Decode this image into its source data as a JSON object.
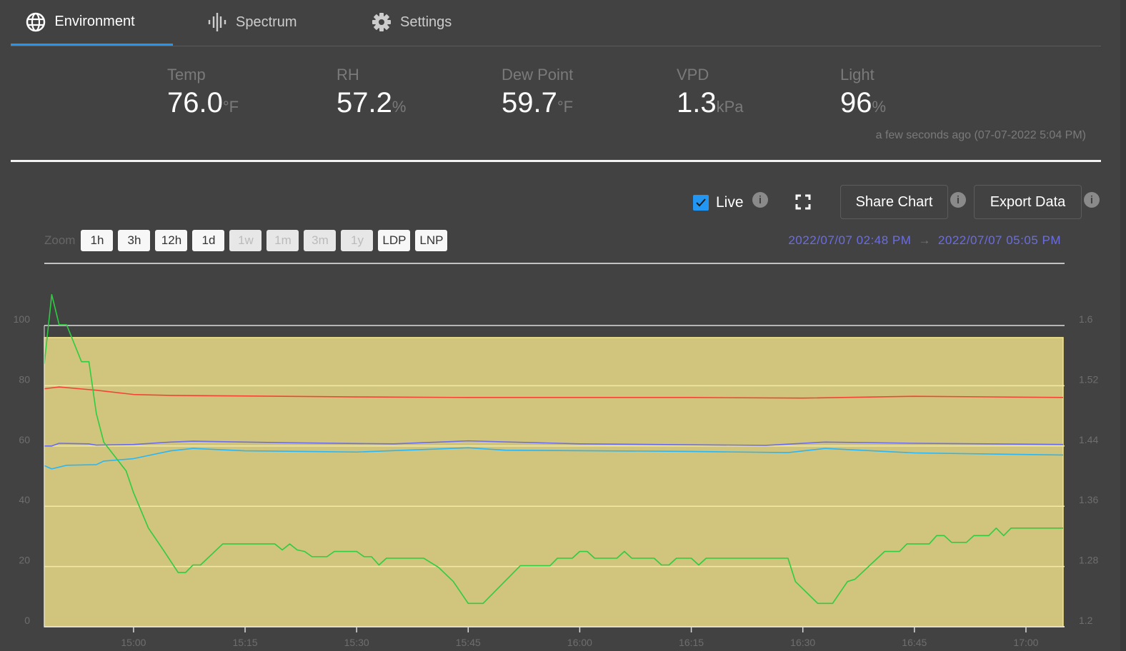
{
  "tabs": [
    {
      "label": "Environment",
      "icon": "globe-icon",
      "active": true
    },
    {
      "label": "Spectrum",
      "icon": "spectrum-icon",
      "active": false
    },
    {
      "label": "Settings",
      "icon": "gear-icon",
      "active": false
    }
  ],
  "metrics": [
    {
      "label": "Temp",
      "value": "76.0",
      "unit": "°F"
    },
    {
      "label": "RH",
      "value": "57.2",
      "unit": "%"
    },
    {
      "label": "Dew Point",
      "value": "59.7",
      "unit": "°F"
    },
    {
      "label": "VPD",
      "value": "1.3",
      "unit": "kPa"
    },
    {
      "label": "Light",
      "value": "96",
      "unit": "%"
    }
  ],
  "updated": "a few seconds ago (07-07-2022 5:04 PM)",
  "toolbar": {
    "live_label": "Live",
    "live_checked": true,
    "share_label": "Share Chart",
    "export_label": "Export Data"
  },
  "zoom": {
    "label": "Zoom",
    "buttons": [
      {
        "label": "1h",
        "enabled": true
      },
      {
        "label": "3h",
        "enabled": true
      },
      {
        "label": "12h",
        "enabled": true
      },
      {
        "label": "1d",
        "enabled": true
      },
      {
        "label": "1w",
        "enabled": false
      },
      {
        "label": "1m",
        "enabled": false
      },
      {
        "label": "3m",
        "enabled": false
      },
      {
        "label": "1y",
        "enabled": false
      },
      {
        "label": "LDP",
        "enabled": true
      },
      {
        "label": "LNP",
        "enabled": true
      }
    ]
  },
  "range": {
    "from": "2022/07/07 02:48 PM",
    "arrow": "→",
    "to": "2022/07/07 05:05 PM"
  },
  "colors": {
    "accent": "#2196f3",
    "temp": "#f44336",
    "rh": "#6a6cf0",
    "dew_point": "#29b6f6",
    "vpd": "#2ecc40",
    "light": "#d1c57e"
  },
  "chart_data": {
    "type": "line",
    "x_range": [
      "14:48",
      "17:05"
    ],
    "x_ticks": [
      "15:00",
      "15:15",
      "15:30",
      "15:45",
      "16:00",
      "16:15",
      "16:30",
      "16:45",
      "17:00"
    ],
    "y_left": {
      "range": [
        0,
        100
      ],
      "ticks": [
        "0",
        "20",
        "40",
        "60",
        "80",
        "100"
      ]
    },
    "y_right": {
      "range": [
        1.2,
        1.6
      ],
      "ticks": [
        "1.2",
        "1.28",
        "1.36",
        "1.44",
        "1.52",
        "1.6"
      ]
    },
    "grid": true,
    "series": [
      {
        "key": "light",
        "axis": "left",
        "style": "area",
        "points": [
          [
            "14:48",
            96
          ],
          [
            "17:05",
            96
          ]
        ]
      },
      {
        "key": "temp",
        "axis": "left",
        "points": [
          [
            "14:48",
            79.0
          ],
          [
            "14:50",
            79.6
          ],
          [
            "14:55",
            78.5
          ],
          [
            "15:00",
            77.1
          ],
          [
            "15:05",
            76.8
          ],
          [
            "15:30",
            76.3
          ],
          [
            "15:45",
            76.1
          ],
          [
            "16:15",
            76.1
          ],
          [
            "16:30",
            75.9
          ],
          [
            "16:45",
            76.5
          ],
          [
            "17:05",
            76.1
          ]
        ]
      },
      {
        "key": "rh",
        "axis": "left",
        "points": [
          [
            "14:48",
            60.0
          ],
          [
            "14:49",
            60.0
          ],
          [
            "14:50",
            60.9
          ],
          [
            "14:54",
            60.7
          ],
          [
            "14:55",
            60.3
          ],
          [
            "15:00",
            60.5
          ],
          [
            "15:05",
            61.3
          ],
          [
            "15:08",
            61.6
          ],
          [
            "15:20",
            61.1
          ],
          [
            "15:35",
            60.7
          ],
          [
            "15:45",
            61.7
          ],
          [
            "16:00",
            60.7
          ],
          [
            "16:25",
            60.2
          ],
          [
            "16:33",
            61.3
          ],
          [
            "16:45",
            60.9
          ],
          [
            "17:05",
            60.5
          ]
        ]
      },
      {
        "key": "dew_point",
        "axis": "left",
        "points": [
          [
            "14:48",
            53.5
          ],
          [
            "14:49",
            52.4
          ],
          [
            "14:51",
            53.6
          ],
          [
            "14:55",
            53.8
          ],
          [
            "14:56",
            55.0
          ],
          [
            "15:00",
            55.8
          ],
          [
            "15:05",
            58.4
          ],
          [
            "15:08",
            59.2
          ],
          [
            "15:15",
            58.4
          ],
          [
            "15:30",
            58.0
          ],
          [
            "15:45",
            59.4
          ],
          [
            "15:50",
            58.6
          ],
          [
            "16:15",
            58.2
          ],
          [
            "16:28",
            57.8
          ],
          [
            "16:33",
            59.2
          ],
          [
            "16:45",
            57.7
          ],
          [
            "17:05",
            57.0
          ]
        ]
      },
      {
        "key": "vpd",
        "axis": "right",
        "points": [
          [
            "14:48",
            1.549
          ],
          [
            "14:49",
            1.641
          ],
          [
            "14:50",
            1.601
          ],
          [
            "14:51",
            1.601
          ],
          [
            "14:53",
            1.552
          ],
          [
            "14:54",
            1.552
          ],
          [
            "14:55",
            1.483
          ],
          [
            "14:56",
            1.445
          ],
          [
            "14:59",
            1.407
          ],
          [
            "15:00",
            1.378
          ],
          [
            "15:02",
            1.331
          ],
          [
            "15:04",
            1.302
          ],
          [
            "15:06",
            1.272
          ],
          [
            "15:07",
            1.272
          ],
          [
            "15:08",
            1.282
          ],
          [
            "15:09",
            1.282
          ],
          [
            "15:12",
            1.31
          ],
          [
            "15:19",
            1.31
          ],
          [
            "15:20",
            1.302
          ],
          [
            "15:21",
            1.31
          ],
          [
            "15:22",
            1.302
          ],
          [
            "15:23",
            1.3
          ],
          [
            "15:24",
            1.293
          ],
          [
            "15:26",
            1.293
          ],
          [
            "15:27",
            1.3
          ],
          [
            "15:30",
            1.3
          ],
          [
            "15:31",
            1.293
          ],
          [
            "15:32",
            1.293
          ],
          [
            "15:33",
            1.282
          ],
          [
            "15:34",
            1.291
          ],
          [
            "15:39",
            1.291
          ],
          [
            "15:41",
            1.279
          ],
          [
            "15:43",
            1.26
          ],
          [
            "15:45",
            1.231
          ],
          [
            "15:47",
            1.231
          ],
          [
            "15:52",
            1.281
          ],
          [
            "15:56",
            1.281
          ],
          [
            "15:57",
            1.291
          ],
          [
            "15:59",
            1.291
          ],
          [
            "16:00",
            1.3
          ],
          [
            "16:01",
            1.3
          ],
          [
            "16:02",
            1.291
          ],
          [
            "16:05",
            1.291
          ],
          [
            "16:06",
            1.3
          ],
          [
            "16:07",
            1.291
          ],
          [
            "16:10",
            1.291
          ],
          [
            "16:11",
            1.282
          ],
          [
            "16:12",
            1.282
          ],
          [
            "16:13",
            1.291
          ],
          [
            "16:15",
            1.291
          ],
          [
            "16:16",
            1.282
          ],
          [
            "16:17",
            1.291
          ],
          [
            "16:28",
            1.291
          ],
          [
            "16:29",
            1.26
          ],
          [
            "16:32",
            1.231
          ],
          [
            "16:34",
            1.231
          ],
          [
            "16:36",
            1.26
          ],
          [
            "16:37",
            1.263
          ],
          [
            "16:41",
            1.3
          ],
          [
            "16:43",
            1.3
          ],
          [
            "16:44",
            1.31
          ],
          [
            "16:47",
            1.31
          ],
          [
            "16:48",
            1.321
          ],
          [
            "16:49",
            1.321
          ],
          [
            "16:50",
            1.312
          ],
          [
            "16:52",
            1.312
          ],
          [
            "16:53",
            1.321
          ],
          [
            "16:55",
            1.321
          ],
          [
            "16:56",
            1.331
          ],
          [
            "16:57",
            1.321
          ],
          [
            "16:58",
            1.331
          ],
          [
            "17:05",
            1.331
          ]
        ]
      }
    ]
  }
}
